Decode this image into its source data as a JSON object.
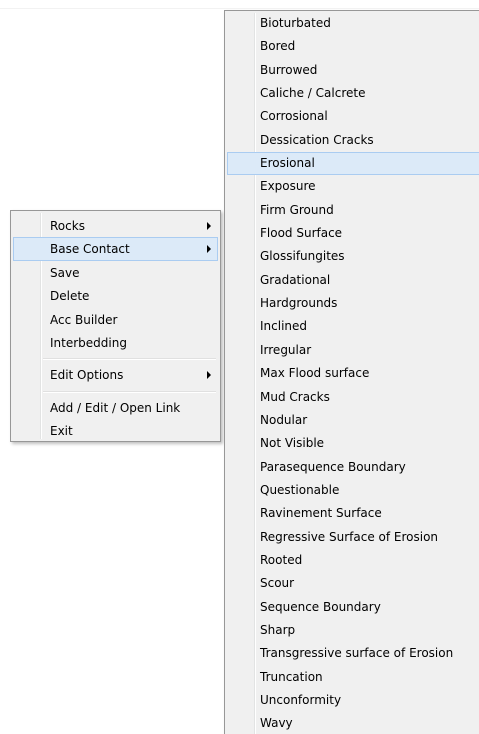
{
  "context_menu": {
    "items": [
      {
        "label": "Rocks",
        "has_submenu": true
      },
      {
        "label": "Base Contact",
        "has_submenu": true,
        "highlighted": true
      },
      {
        "label": "Save"
      },
      {
        "label": "Delete"
      },
      {
        "label": "Acc Builder"
      },
      {
        "label": "Interbedding"
      },
      {
        "label": "Edit Options",
        "has_submenu": true
      },
      {
        "label": "Add / Edit / Open Link"
      },
      {
        "label": "Exit"
      }
    ]
  },
  "submenu": {
    "items": [
      "Bioturbated",
      "Bored",
      "Burrowed",
      "Caliche / Calcrete",
      "Corrosional",
      "Dessication Cracks",
      "Erosional",
      "Exposure",
      "Firm Ground",
      "Flood Surface",
      "Glossifungites",
      "Gradational",
      "Hardgrounds",
      "Inclined",
      "Irregular",
      "Max Flood surface",
      "Mud Cracks",
      "Nodular",
      "Not Visible",
      "Parasequence Boundary",
      "Questionable",
      "Ravinement Surface",
      "Regressive Surface of Erosion",
      "Rooted",
      "Scour",
      "Sequence Boundary",
      "Sharp",
      "Transgressive surface of Erosion",
      "Truncation",
      "Unconformity",
      "Wavy"
    ],
    "highlighted_item": "Erosional"
  },
  "colors": {
    "menu_background": "#f0f0f0",
    "menu_border": "#979797",
    "highlight_background": "#dceaf8",
    "highlight_border": "#aaccf1"
  }
}
